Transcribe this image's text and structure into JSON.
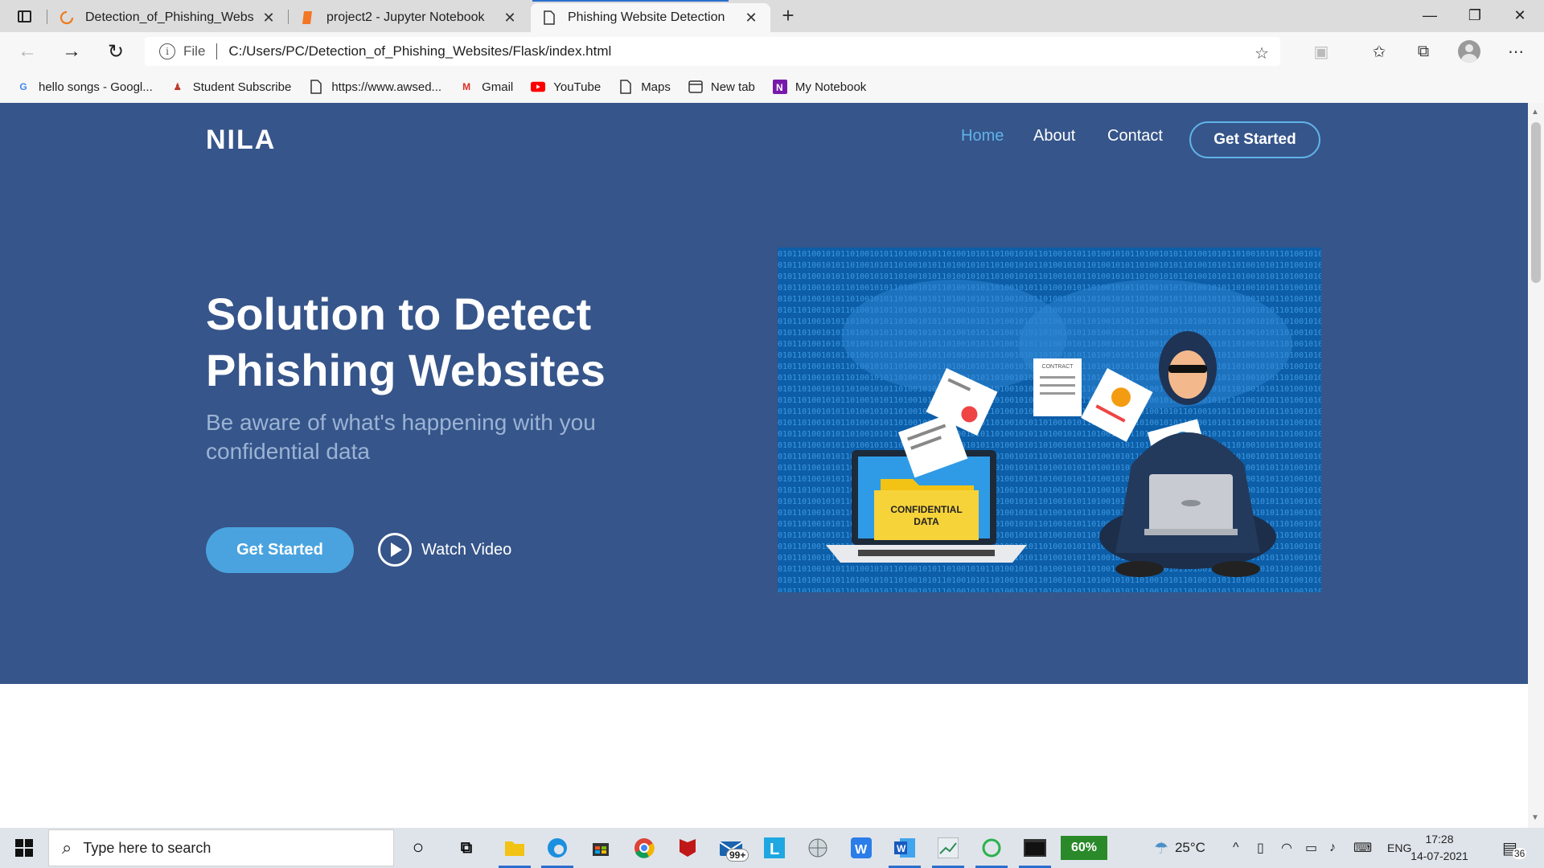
{
  "browser": {
    "tabs": [
      {
        "title": "Detection_of_Phishing_Websites",
        "active": false
      },
      {
        "title": "project2 - Jupyter Notebook",
        "active": false
      },
      {
        "title": "Phishing Website Detection",
        "active": true
      }
    ],
    "address": {
      "scheme": "File",
      "url": "C:/Users/PC/Detection_of_Phishing_Websites/Flask/index.html"
    },
    "bookmarks": [
      {
        "label": "hello songs - Googl...",
        "icon": "google-icon"
      },
      {
        "label": "Student Subscribe",
        "icon": "student-icon"
      },
      {
        "label": "https://www.awsed...",
        "icon": "page-icon"
      },
      {
        "label": "Gmail",
        "icon": "gmail-icon"
      },
      {
        "label": "YouTube",
        "icon": "youtube-icon"
      },
      {
        "label": "Maps",
        "icon": "page-icon"
      },
      {
        "label": "New tab",
        "icon": "newtab-icon"
      },
      {
        "label": "My Notebook",
        "icon": "onenote-icon"
      }
    ]
  },
  "site": {
    "brand": "NILA",
    "nav": {
      "home": "Home",
      "about": "About",
      "contact": "Contact",
      "cta": "Get Started"
    },
    "hero": {
      "title_line1": "Solution to Detect",
      "title_line2": "Phishing Websites",
      "subtitle": "Be aware of what's happening with you confidential data",
      "cta": "Get Started",
      "watch": "Watch Video"
    },
    "illustration": {
      "folder_label_1": "CONFIDENTIAL",
      "folder_label_2": "DATA",
      "doc_label": "CONTRACT"
    }
  },
  "taskbar": {
    "search_placeholder": "Type here to search",
    "mail_badge": "99+",
    "battery_percent": "60%",
    "temperature": "25°C",
    "language": "ENG",
    "time": "17:28",
    "date": "14-07-2021",
    "notification_count": "36"
  },
  "colors": {
    "hero_bg": "#36558a",
    "accent": "#4aa3df",
    "active_link": "#5fb3e8"
  }
}
